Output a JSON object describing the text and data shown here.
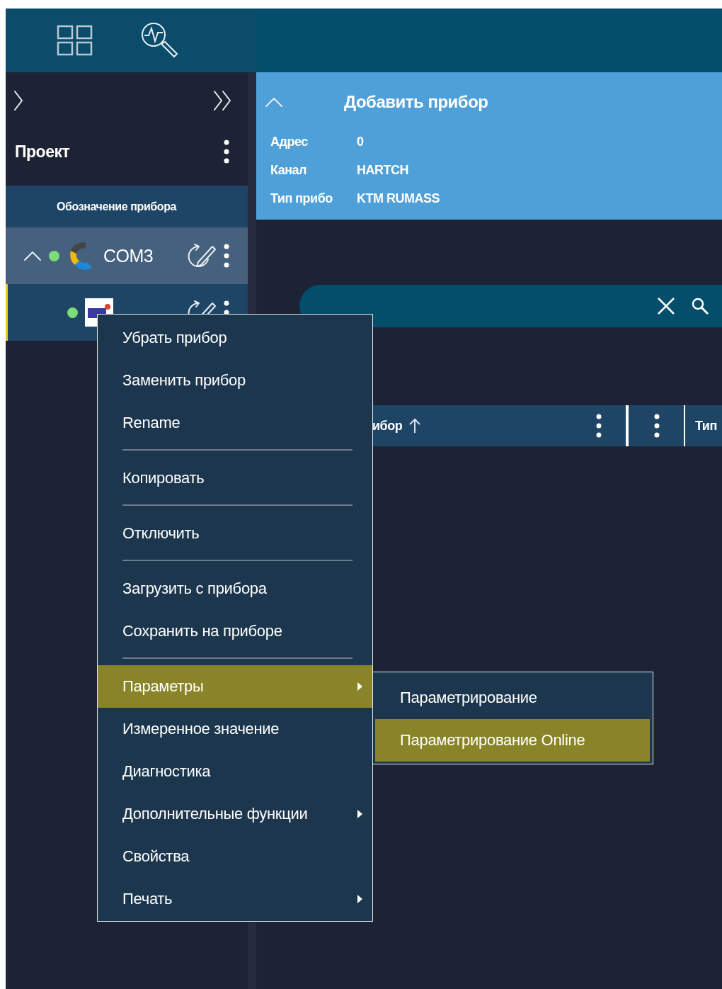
{
  "sidebar": {
    "title": "Проект",
    "column_header": "Обозначение прибора",
    "tree": [
      {
        "label": "COM3",
        "connected": true,
        "expanded": true,
        "selected": false,
        "children": [
          {
            "connected": true,
            "selected": true
          }
        ]
      }
    ]
  },
  "device_panel": {
    "title": "Добавить прибор",
    "expanded": true,
    "fields": [
      {
        "label": "Адрес",
        "value": "0"
      },
      {
        "label": "Канал",
        "value": "HARTCH"
      },
      {
        "label": "Тип прибо",
        "value": "KTM RUMASS"
      }
    ]
  },
  "table": {
    "columns": [
      {
        "label": "ибор",
        "sort_ascending": true,
        "menu": true
      },
      {
        "menu": true
      },
      {
        "label": "Тип",
        "menu": false
      }
    ]
  },
  "context_menu": {
    "items": [
      {
        "kind": "item",
        "label": "Убрать прибор",
        "selected": false,
        "submenu": false
      },
      {
        "kind": "item",
        "label": "Заменить прибор",
        "selected": false,
        "submenu": false
      },
      {
        "kind": "item",
        "label": "Rename",
        "selected": false,
        "submenu": false
      },
      {
        "kind": "separator"
      },
      {
        "kind": "item",
        "label": "Копировать",
        "selected": false,
        "submenu": false
      },
      {
        "kind": "separator"
      },
      {
        "kind": "item",
        "label": "Отключить",
        "selected": false,
        "submenu": false
      },
      {
        "kind": "separator"
      },
      {
        "kind": "item",
        "label": "Загрузить с прибора",
        "selected": false,
        "submenu": false
      },
      {
        "kind": "item",
        "label": "Сохранить на приборе",
        "selected": false,
        "submenu": false
      },
      {
        "kind": "separator"
      },
      {
        "kind": "item",
        "label": "Параметры",
        "selected": true,
        "submenu": true
      },
      {
        "kind": "item",
        "label": "Измеренное значение",
        "selected": false,
        "submenu": false
      },
      {
        "kind": "item",
        "label": "Диагностика",
        "selected": false,
        "submenu": false
      },
      {
        "kind": "item",
        "label": "Дополнительные функции",
        "selected": false,
        "submenu": true
      },
      {
        "kind": "item",
        "label": "Свойства",
        "selected": false,
        "submenu": false
      },
      {
        "kind": "item",
        "label": "Печать",
        "selected": false,
        "submenu": true
      }
    ]
  },
  "submenu": {
    "items": [
      {
        "label": "Параметрирование",
        "selected": false
      },
      {
        "label": "Параметрирование Online",
        "selected": true
      }
    ]
  }
}
